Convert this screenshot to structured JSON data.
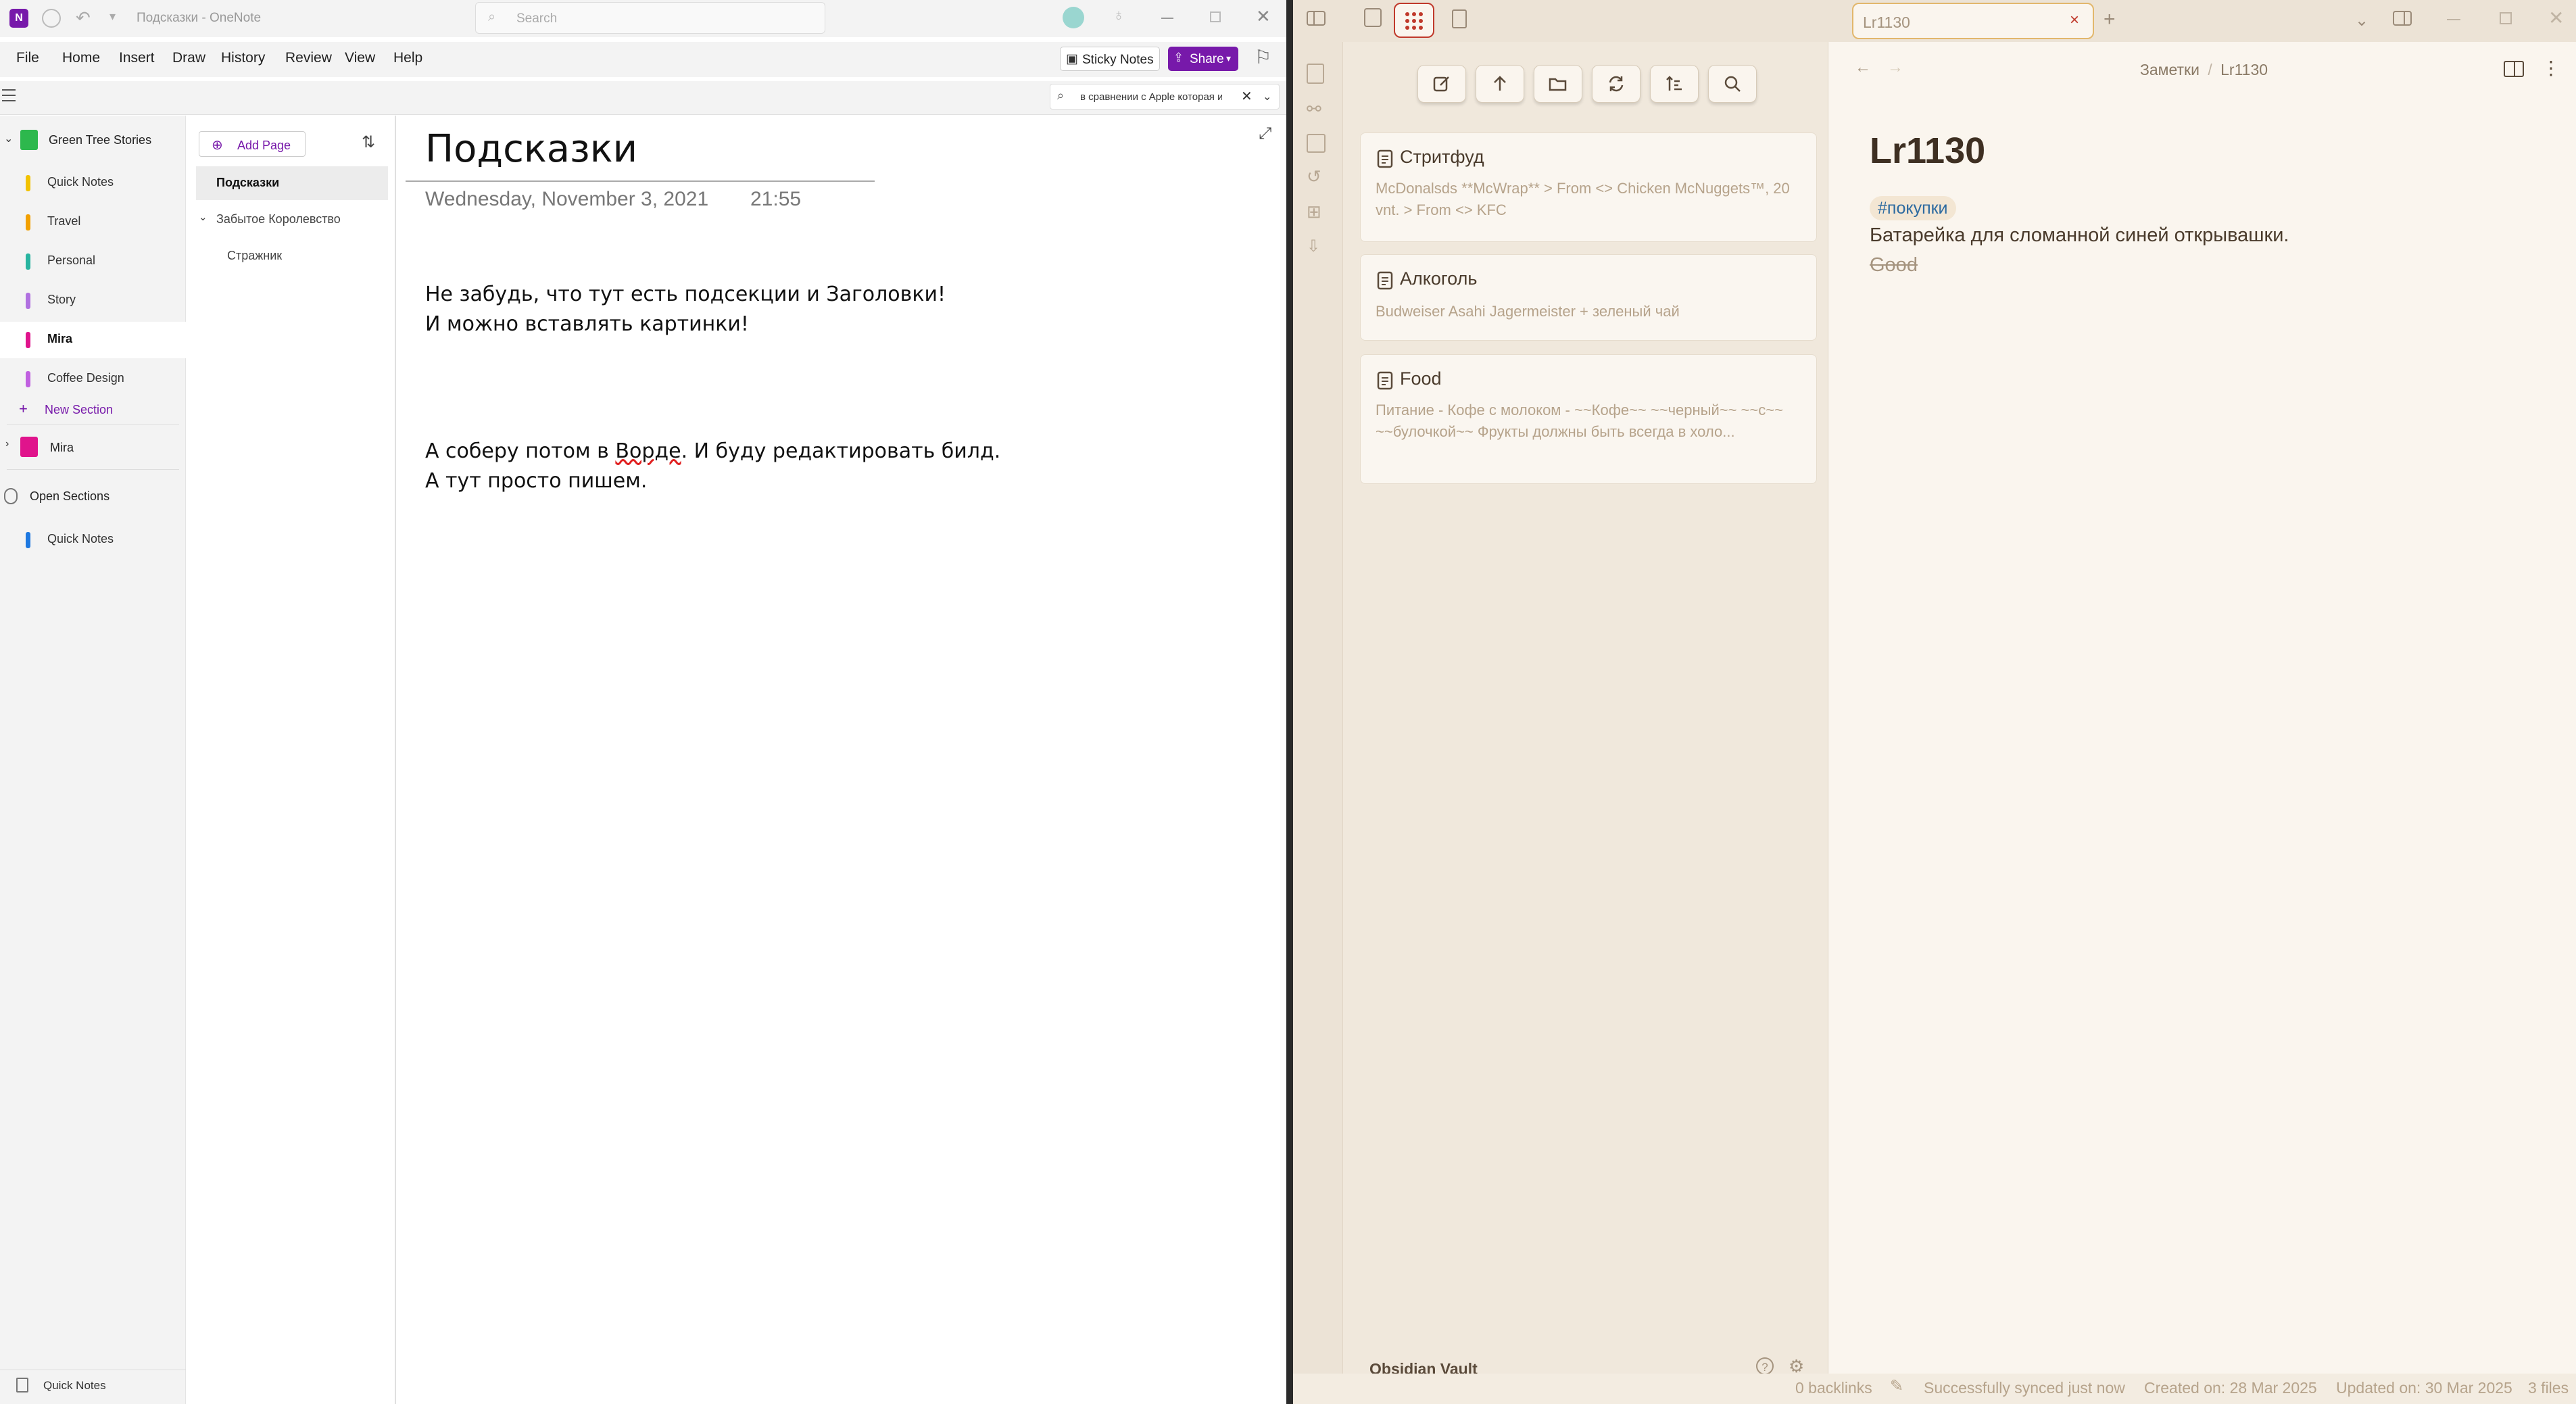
{
  "onenote": {
    "window_title": "Подсказки - OneNote",
    "search_placeholder": "Search",
    "menu": [
      "File",
      "Home",
      "Insert",
      "Draw",
      "History",
      "Review",
      "View",
      "Help"
    ],
    "sticky_notes": "Sticky Notes",
    "share": "Share",
    "find_value": "в сравнении с Apple которая им",
    "notebook_name": "Green Tree Stories",
    "sections": [
      {
        "label": "Quick Notes",
        "color": "#f2c200"
      },
      {
        "label": "Travel",
        "color": "#f2a000"
      },
      {
        "label": "Personal",
        "color": "#28b4a0"
      },
      {
        "label": "Story",
        "color": "#b070e0"
      },
      {
        "label": "Mira",
        "color": "#e0148c"
      },
      {
        "label": "Coffee Design",
        "color": "#c060e0"
      }
    ],
    "new_section": "New Section",
    "notebook2": "Mira",
    "open_sections": "Open Sections",
    "open_quick_notes": "Quick Notes",
    "footer_quick_notes": "Quick Notes",
    "add_page": "Add Page",
    "pages": [
      {
        "label": "Подсказки"
      },
      {
        "label": "Забытое Королевство"
      },
      {
        "label": "Стражник"
      }
    ],
    "page_title": "Подсказки",
    "page_date": "Wednesday, November 3, 2021",
    "page_time": "21:55",
    "body_lines": [
      "Не забудь, что тут есть подсекции и Заголовки!",
      "И можно вставлять картинки!",
      "А соберу потом в ",
      "Ворде",
      ". И буду редактировать билд.",
      "А тут просто пишем."
    ]
  },
  "obsidian": {
    "tab_title": "Lr1130",
    "breadcrumb_folder": "Заметки",
    "breadcrumb_sep": "/",
    "breadcrumb_note": "Lr1130",
    "cards": [
      {
        "title": "Стритфуд",
        "preview": "McDonalsds **McWrap** > From <> Chicken McNuggets™, 20 vnt. > From <> KFC"
      },
      {
        "title": "Алкоголь",
        "preview": "Budweiser Asahi Jagermeister + зеленый чай"
      },
      {
        "title": "Food",
        "preview": "Питание - Кофе с молоком - ~~Кофе~~ ~~черный~~ ~~с~~ ~~булочкой~~ Фрукты должны быть всегда в холо..."
      }
    ],
    "vault_name": "Obsidian Vault",
    "note_title": "Lr1130",
    "tag": "#покупки",
    "body": "Батарейка для сломанной синей открывашки.",
    "struck": "Good",
    "status": {
      "backlinks": "0 backlinks",
      "sync": "Successfully synced just now",
      "created": "Created on: 28 Mar 2025",
      "updated": "Updated on: 30 Mar 2025",
      "files": "3 files"
    },
    "accent": "#c0392b"
  }
}
